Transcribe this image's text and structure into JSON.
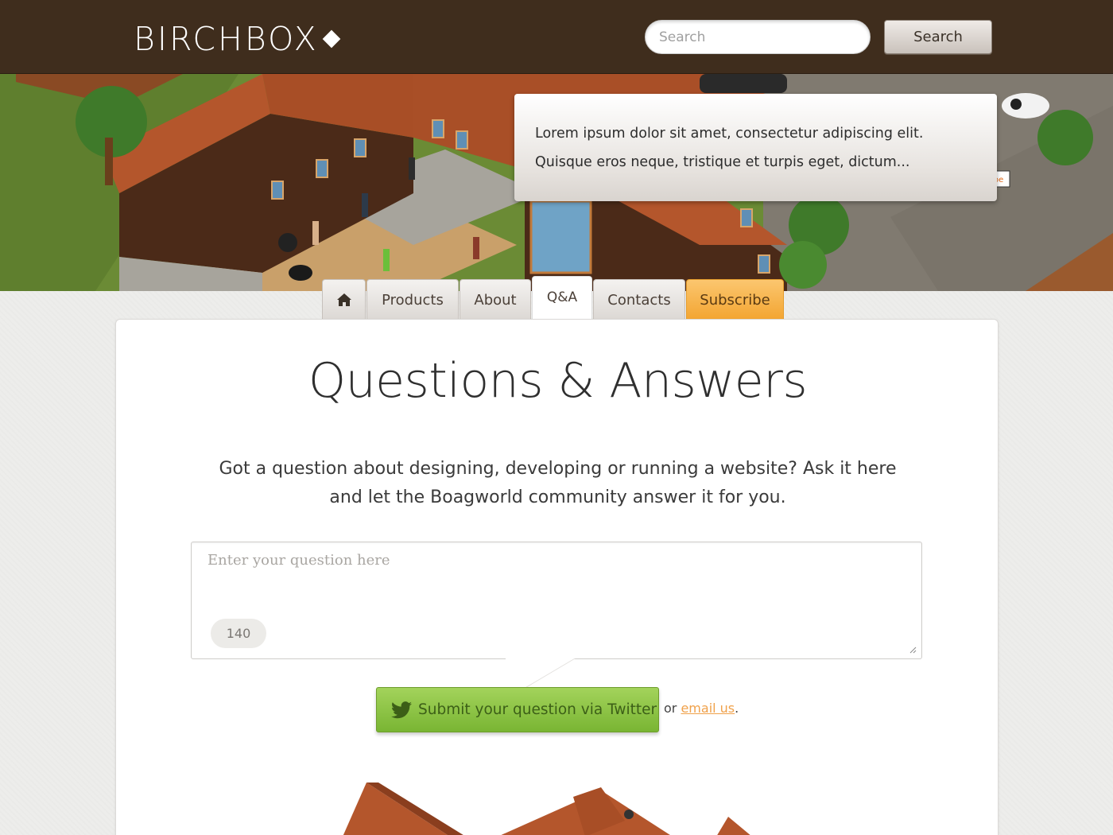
{
  "header": {
    "logo_text": "BIRCHBOX",
    "search_placeholder": "Search",
    "search_button_label": "Search"
  },
  "hero": {
    "callout_lines": [
      "Lorem ipsum dolor sit amet, consectetur adipiscing elit.",
      "Quisque eros neque, tristique et turpis eget, dictum..."
    ],
    "sign_text": "oe"
  },
  "tabs": {
    "home_icon": "home-icon",
    "items": [
      {
        "label": "Products"
      },
      {
        "label": "About"
      },
      {
        "label": "Q&A",
        "active": true
      },
      {
        "label": "Contacts"
      },
      {
        "label": "Subscribe",
        "highlight": true
      }
    ]
  },
  "main": {
    "title": "Questions & Answers",
    "intro_line1": "Got a question about designing, developing or running a website? Ask it here",
    "intro_line2": "and let the Boagworld community answer it for you.",
    "question_placeholder": "Enter your question here",
    "char_count": "140",
    "twitter_button_label": "Submit your question via Twitter",
    "twitter_icon": "twitter-bird-icon",
    "or_text": "or ",
    "email_link_label": "email us",
    "trailing_period": "."
  },
  "colors": {
    "header_bg": "#3f2d1d",
    "subscribe_tab": "#f3a531",
    "twitter_button": "#79b533",
    "email_link": "#f0a14a"
  }
}
